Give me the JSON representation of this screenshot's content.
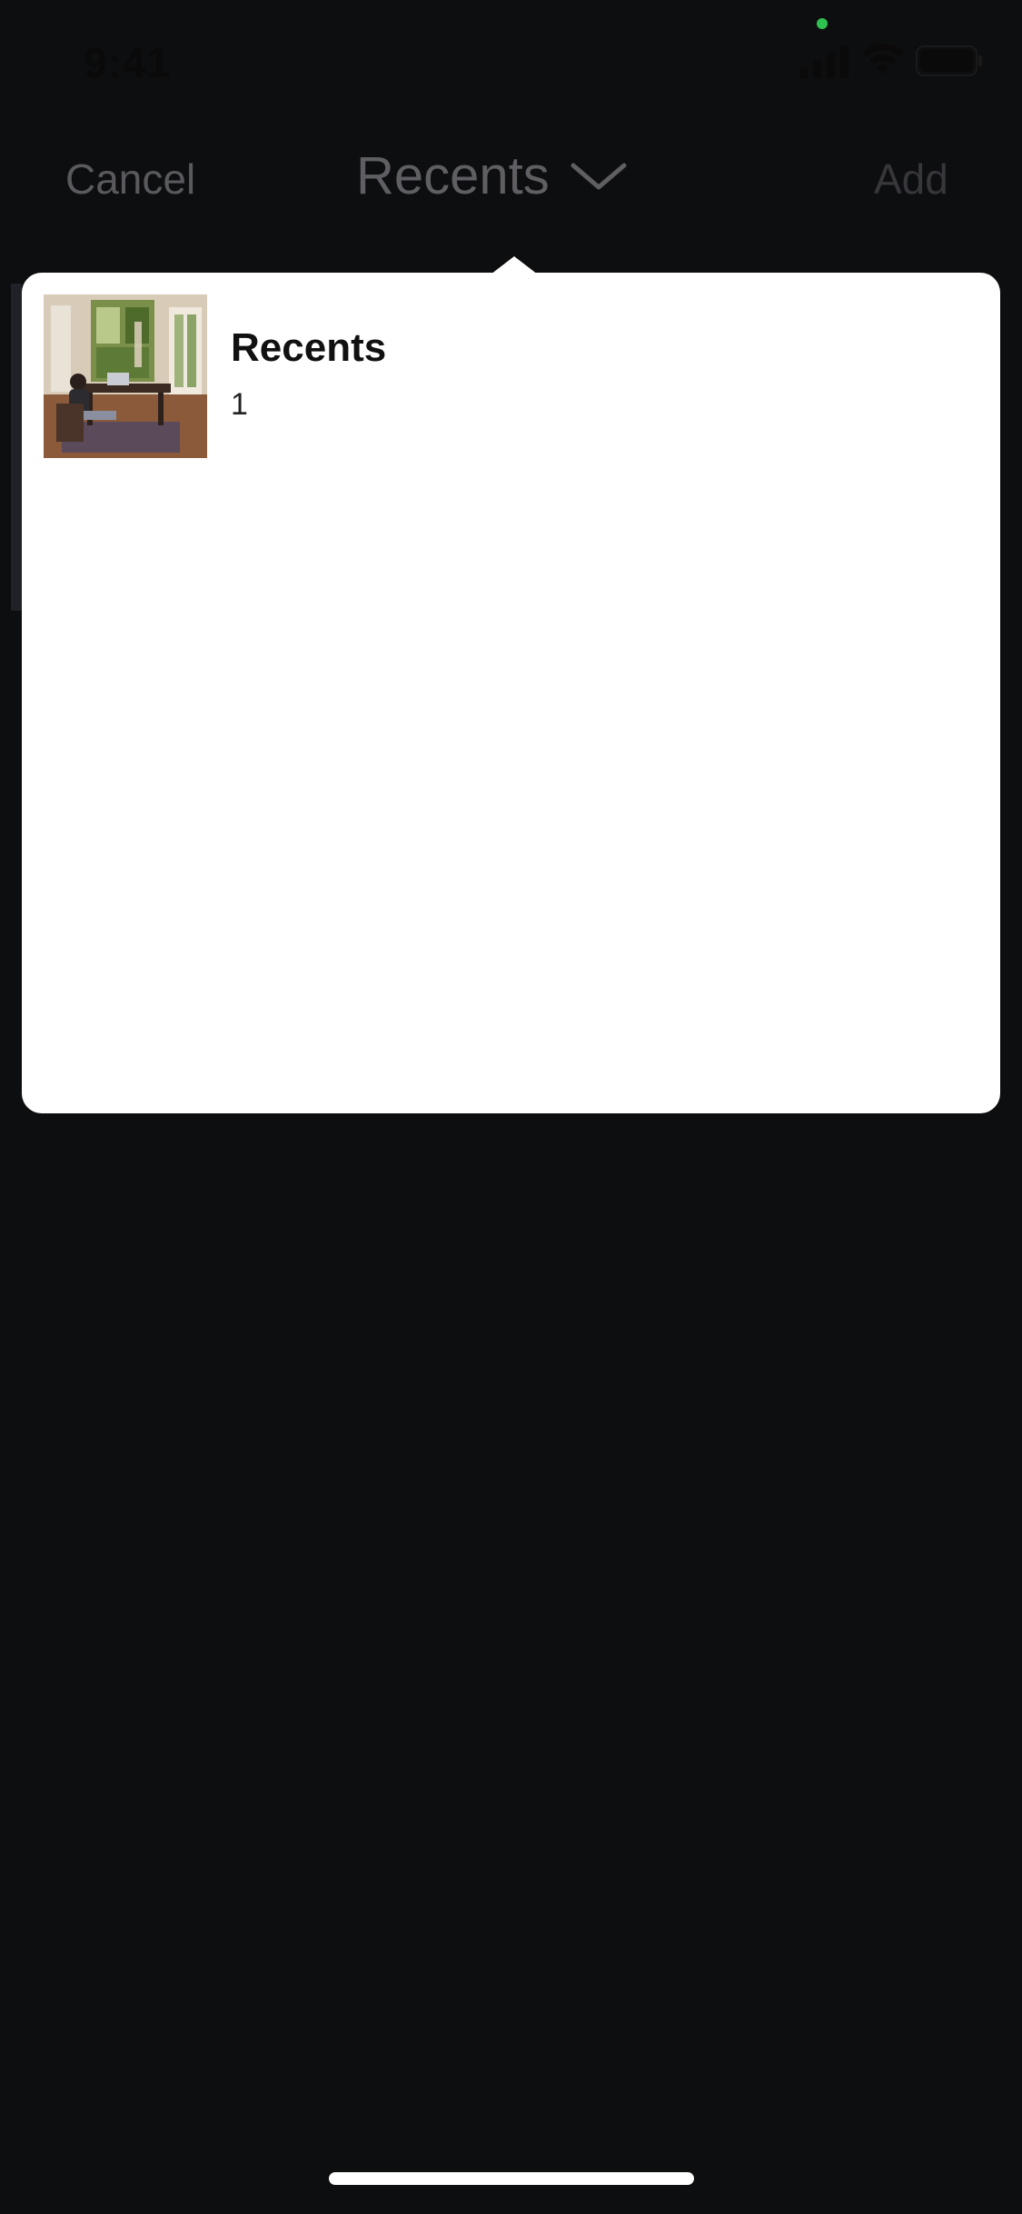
{
  "status_bar": {
    "time": "9:41"
  },
  "nav": {
    "cancel_label": "Cancel",
    "title": "Recents",
    "add_label": "Add"
  },
  "popover": {
    "albums": [
      {
        "name": "Recents",
        "count": "1",
        "thumbnail": "photo-thumbnail-icon"
      }
    ]
  },
  "icons": {
    "signal": "cellular-signal-icon",
    "wifi": "wifi-icon",
    "battery": "battery-icon",
    "chevron": "chevron-down-icon"
  },
  "colors": {
    "background": "#0d0e10",
    "popover": "#ffffff",
    "privacy_indicator": "#2fc14f",
    "nav_text": "#5f5f63"
  }
}
